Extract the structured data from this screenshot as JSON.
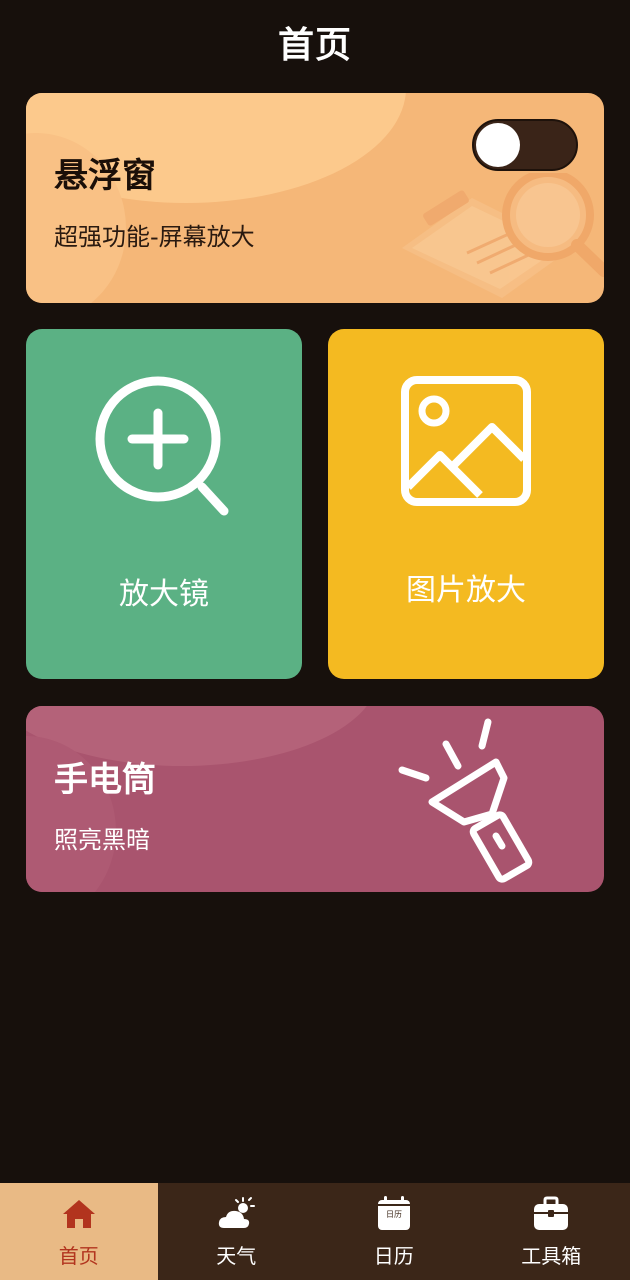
{
  "header": {
    "title": "首页"
  },
  "floating_card": {
    "title": "悬浮窗",
    "subtitle": "超强功能-屏幕放大",
    "toggle_on": false,
    "color": "#f5b778"
  },
  "magnifier_card": {
    "label": "放大镜",
    "icon": "zoom-in-icon",
    "color": "#5bb184"
  },
  "image_zoom_card": {
    "label": "图片放大",
    "icon": "image-icon",
    "color": "#f4ba21"
  },
  "flashlight_card": {
    "title": "手电筒",
    "subtitle": "照亮黑暗",
    "icon": "flashlight-icon",
    "color": "#a9546e"
  },
  "bottom_nav": {
    "active_index": 0,
    "items": [
      {
        "label": "首页",
        "icon": "home-icon"
      },
      {
        "label": "天气",
        "icon": "weather-icon"
      },
      {
        "label": "日历",
        "icon": "calendar-icon",
        "icon_text": "日历"
      },
      {
        "label": "工具箱",
        "icon": "toolbox-icon"
      }
    ],
    "active_color": "#b2341e",
    "active_bg": "#e9ba85"
  }
}
